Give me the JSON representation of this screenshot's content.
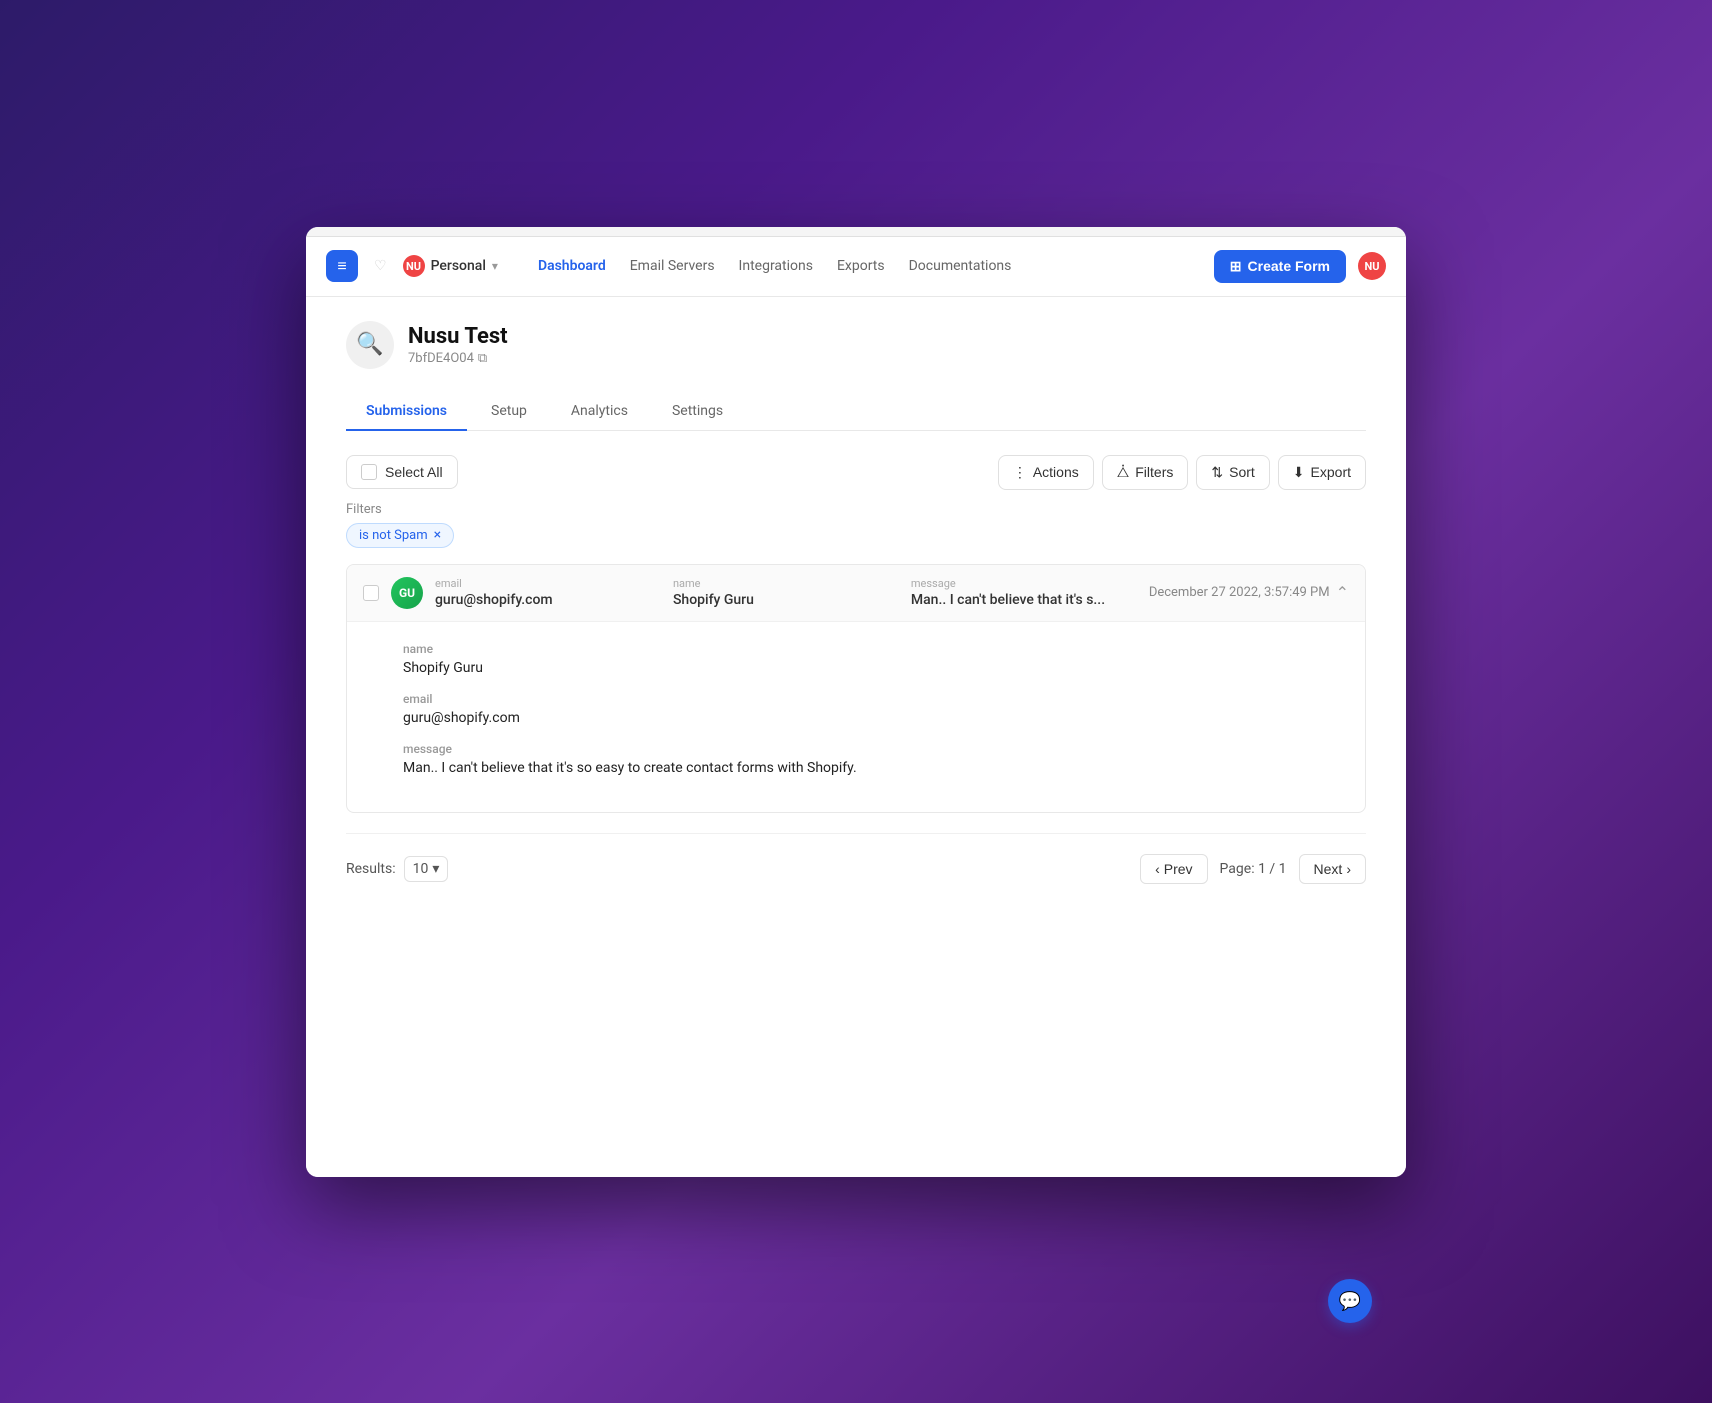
{
  "window": {
    "title": "Nusu Test - Submissions"
  },
  "navbar": {
    "logo_icon": "≡",
    "workspace_label": "Personal",
    "workspace_badge": "NU",
    "user_badge": "NU",
    "nav_links": [
      {
        "id": "dashboard",
        "label": "Dashboard",
        "active": true
      },
      {
        "id": "email-servers",
        "label": "Email Servers",
        "active": false
      },
      {
        "id": "integrations",
        "label": "Integrations",
        "active": false
      },
      {
        "id": "exports",
        "label": "Exports",
        "active": false
      },
      {
        "id": "documentations",
        "label": "Documentations",
        "active": false
      }
    ],
    "create_form_btn": "Create Form"
  },
  "form": {
    "icon": "🔍",
    "title": "Nusu Test",
    "id": "7bfDE4O04",
    "tabs": [
      {
        "id": "submissions",
        "label": "Submissions",
        "active": true
      },
      {
        "id": "setup",
        "label": "Setup",
        "active": false
      },
      {
        "id": "analytics",
        "label": "Analytics",
        "active": false
      },
      {
        "id": "settings",
        "label": "Settings",
        "active": false
      }
    ]
  },
  "toolbar": {
    "select_all": "Select All",
    "actions": "Actions",
    "filters": "Filters",
    "sort": "Sort",
    "export": "Export"
  },
  "filters": {
    "label": "Filters",
    "tags": [
      {
        "id": "not-spam",
        "label": "is not Spam"
      }
    ]
  },
  "submission": {
    "avatar_initials": "GU",
    "email_label": "email",
    "email_value": "guru@shopify.com",
    "name_label": "name",
    "name_value": "Shopify Guru",
    "message_label": "message",
    "message_preview": "Man.. I can't believe that it's s...",
    "timestamp": "December 27 2022, 3:57:49 PM",
    "detail": {
      "name_label": "name",
      "name_value": "Shopify Guru",
      "email_label": "email",
      "email_value": "guru@shopify.com",
      "message_label": "message",
      "message_value": "Man.. I can't believe that it's so easy to create contact forms with Shopify."
    }
  },
  "pagination": {
    "results_label": "Results:",
    "results_count": "10",
    "prev_btn": "Prev",
    "page_info": "Page: 1 / 1",
    "next_btn": "Next"
  }
}
